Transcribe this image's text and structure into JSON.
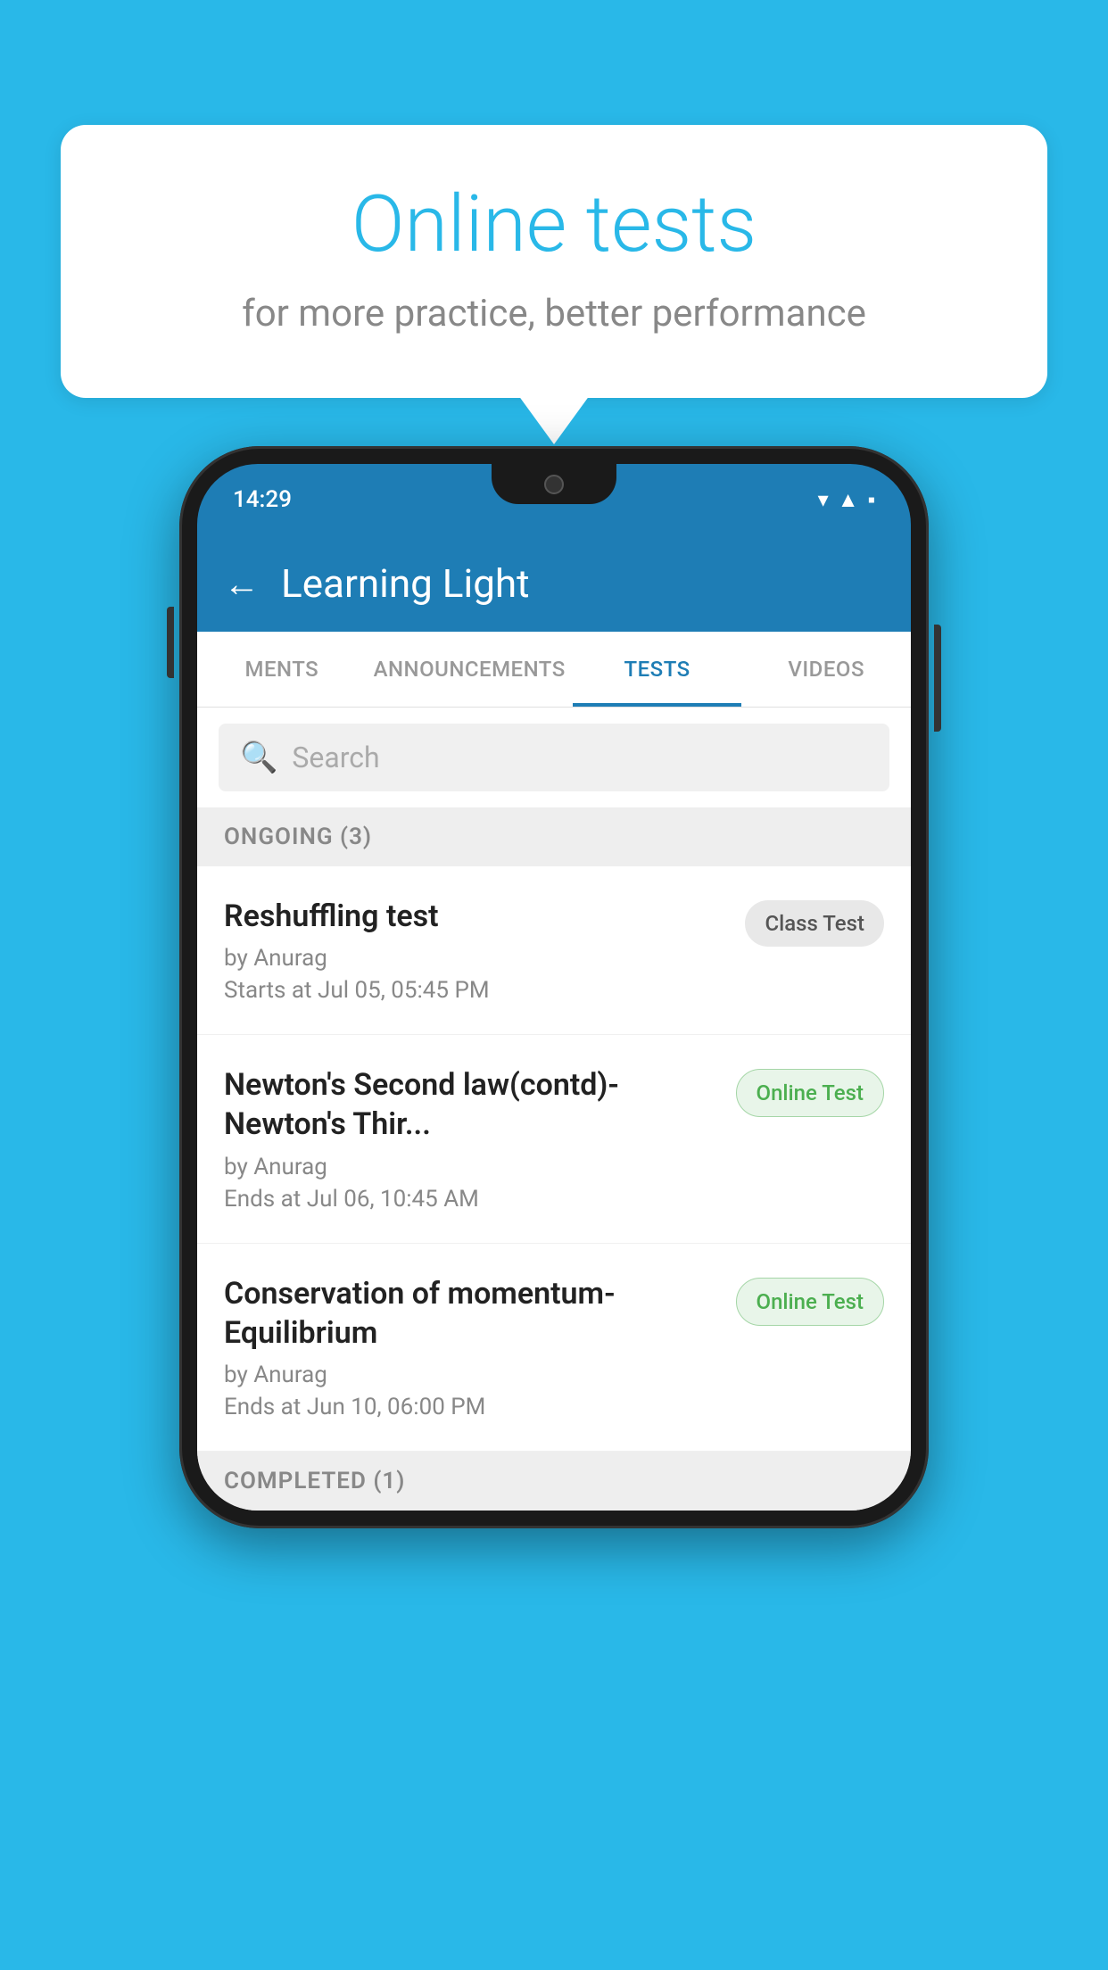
{
  "background_color": "#29b8e8",
  "bubble": {
    "title": "Online tests",
    "subtitle": "for more practice, better performance"
  },
  "phone": {
    "status_bar": {
      "time": "14:29",
      "icons": [
        "wifi",
        "signal",
        "battery"
      ]
    },
    "header": {
      "title": "Learning Light",
      "back_label": "←"
    },
    "tabs": [
      {
        "label": "MENTS",
        "active": false
      },
      {
        "label": "ANNOUNCEMENTS",
        "active": false
      },
      {
        "label": "TESTS",
        "active": true
      },
      {
        "label": "VIDEOS",
        "active": false
      }
    ],
    "search": {
      "placeholder": "Search"
    },
    "section_ongoing": {
      "label": "ONGOING (3)"
    },
    "tests": [
      {
        "name": "Reshuffling test",
        "author": "by Anurag",
        "time_label": "Starts at",
        "time": "Jul 05, 05:45 PM",
        "badge": "Class Test",
        "badge_type": "class"
      },
      {
        "name": "Newton's Second law(contd)-Newton's Thir...",
        "author": "by Anurag",
        "time_label": "Ends at",
        "time": "Jul 06, 10:45 AM",
        "badge": "Online Test",
        "badge_type": "online"
      },
      {
        "name": "Conservation of momentum-Equilibrium",
        "author": "by Anurag",
        "time_label": "Ends at",
        "time": "Jun 10, 06:00 PM",
        "badge": "Online Test",
        "badge_type": "online"
      }
    ],
    "section_completed": {
      "label": "COMPLETED (1)"
    }
  }
}
